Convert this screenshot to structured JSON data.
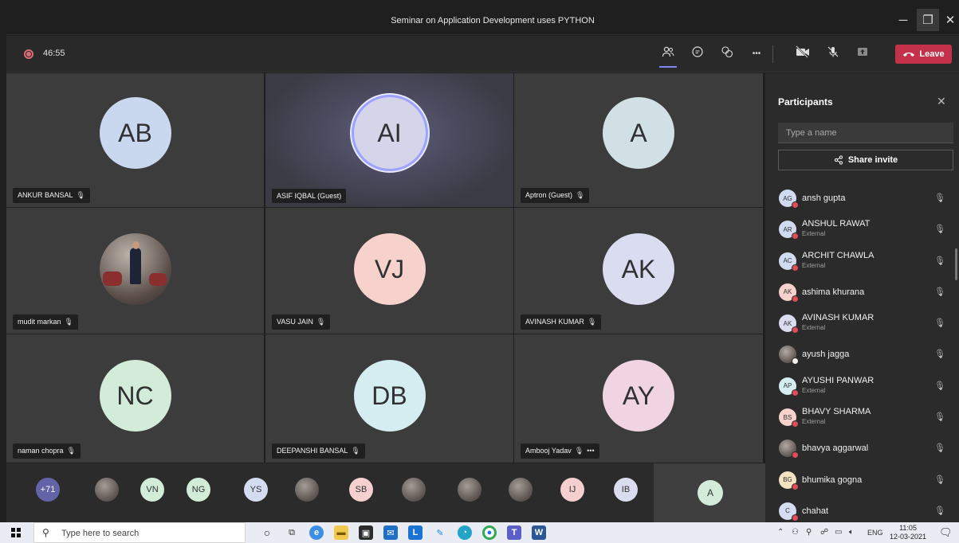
{
  "window": {
    "title": "Seminar on Application Development uses PYTHON",
    "minimize_glyph": "─",
    "maximize_glyph": "❐",
    "close_glyph": "✕"
  },
  "toolbar": {
    "timer": "46:55",
    "leave_label": "Leave",
    "icons": [
      "participants-icon",
      "chat-icon",
      "reactions-icon",
      "more-options-icon",
      "camera-off-icon",
      "mic-off-icon",
      "share-tray-icon",
      "phone-hangup-icon"
    ],
    "more_glyph": "•••"
  },
  "video_tiles": [
    {
      "initials": "AB",
      "name": "ANKUR BANSAL",
      "muted": true,
      "color": "#c9d7ef"
    },
    {
      "initials": "AI",
      "name": "ASIF IQBAL (Guest)",
      "muted": false,
      "color": "#d4d5e8",
      "active_speaker": true
    },
    {
      "initials": "A",
      "name": "Aptron (Guest)",
      "muted": true,
      "color": "#d1e0e4"
    },
    {
      "initials": "",
      "name": "mudit markan",
      "muted": true,
      "photo": true
    },
    {
      "initials": "VJ",
      "name": "VASU JAIN",
      "muted": true,
      "color": "#f7d2cc"
    },
    {
      "initials": "AK",
      "name": "AVINASH KUMAR",
      "muted": true,
      "color": "#dadcf0"
    },
    {
      "initials": "NC",
      "name": "naman chopra",
      "muted": true,
      "color": "#d3ebd9"
    },
    {
      "initials": "DB",
      "name": "DEEPANSHI BANSAL",
      "muted": true,
      "color": "#d5edf0"
    },
    {
      "initials": "AY",
      "name": "Ambooj Yadav",
      "muted": true,
      "color": "#f1d4e1",
      "more": "•••"
    }
  ],
  "overflow_strip": {
    "more_count": "+71",
    "avatars": [
      {
        "initials": "",
        "photo": true
      },
      {
        "initials": "VN",
        "color": "#d2ecd7"
      },
      {
        "initials": "NG",
        "color": "#d2ecd7"
      },
      {
        "initials": "YS",
        "color": "#d3dcf1"
      },
      {
        "initials": "",
        "photo": true
      },
      {
        "initials": "SB",
        "color": "#f6d0cf"
      },
      {
        "initials": "",
        "photo": true
      },
      {
        "initials": "",
        "photo": true
      },
      {
        "initials": "",
        "photo": true
      },
      {
        "initials": "IJ",
        "color": "#f6d0cf"
      },
      {
        "initials": "IB",
        "color": "#dadcef"
      }
    ],
    "self_tile_initial": "A",
    "self_tile_color": "#d3ebd9"
  },
  "participants_panel": {
    "title": "Participants",
    "search_placeholder": "Type a name",
    "share_invite_label": "Share invite",
    "close_glyph": "✕",
    "people": [
      {
        "initials": "AG",
        "name": "ansh gupta",
        "sub": "",
        "color": "#d1dbf0"
      },
      {
        "initials": "AR",
        "name": "ANSHUL RAWAT",
        "sub": "External",
        "color": "#d1dbf0"
      },
      {
        "initials": "AC",
        "name": "ARCHIT CHAWLA",
        "sub": "External",
        "color": "#d1dbf0"
      },
      {
        "initials": "AK",
        "name": "ashima khurana",
        "sub": "",
        "color": "#f7d2cc"
      },
      {
        "initials": "AK",
        "name": "AVINASH KUMAR",
        "sub": "External",
        "color": "#dadcf0"
      },
      {
        "initials": "",
        "name": "ayush jagga",
        "sub": "",
        "photo": true,
        "away": true
      },
      {
        "initials": "AP",
        "name": "AYUSHI PANWAR",
        "sub": "External",
        "color": "#d5edf0"
      },
      {
        "initials": "BS",
        "name": "BHAVY SHARMA",
        "sub": "External",
        "color": "#f7d2cc"
      },
      {
        "initials": "",
        "name": "bhavya aggarwal",
        "sub": "",
        "photo": true
      },
      {
        "initials": "BG",
        "name": "bhumika gogna",
        "sub": "",
        "color": "#f3e4bf"
      },
      {
        "initials": "C",
        "name": "chahat",
        "sub": "",
        "color": "#d3dcf1"
      }
    ]
  },
  "taskbar": {
    "search_placeholder": "Type here to search",
    "tray_language": "ENG",
    "time": "11:05",
    "date": "12-03-2021"
  }
}
